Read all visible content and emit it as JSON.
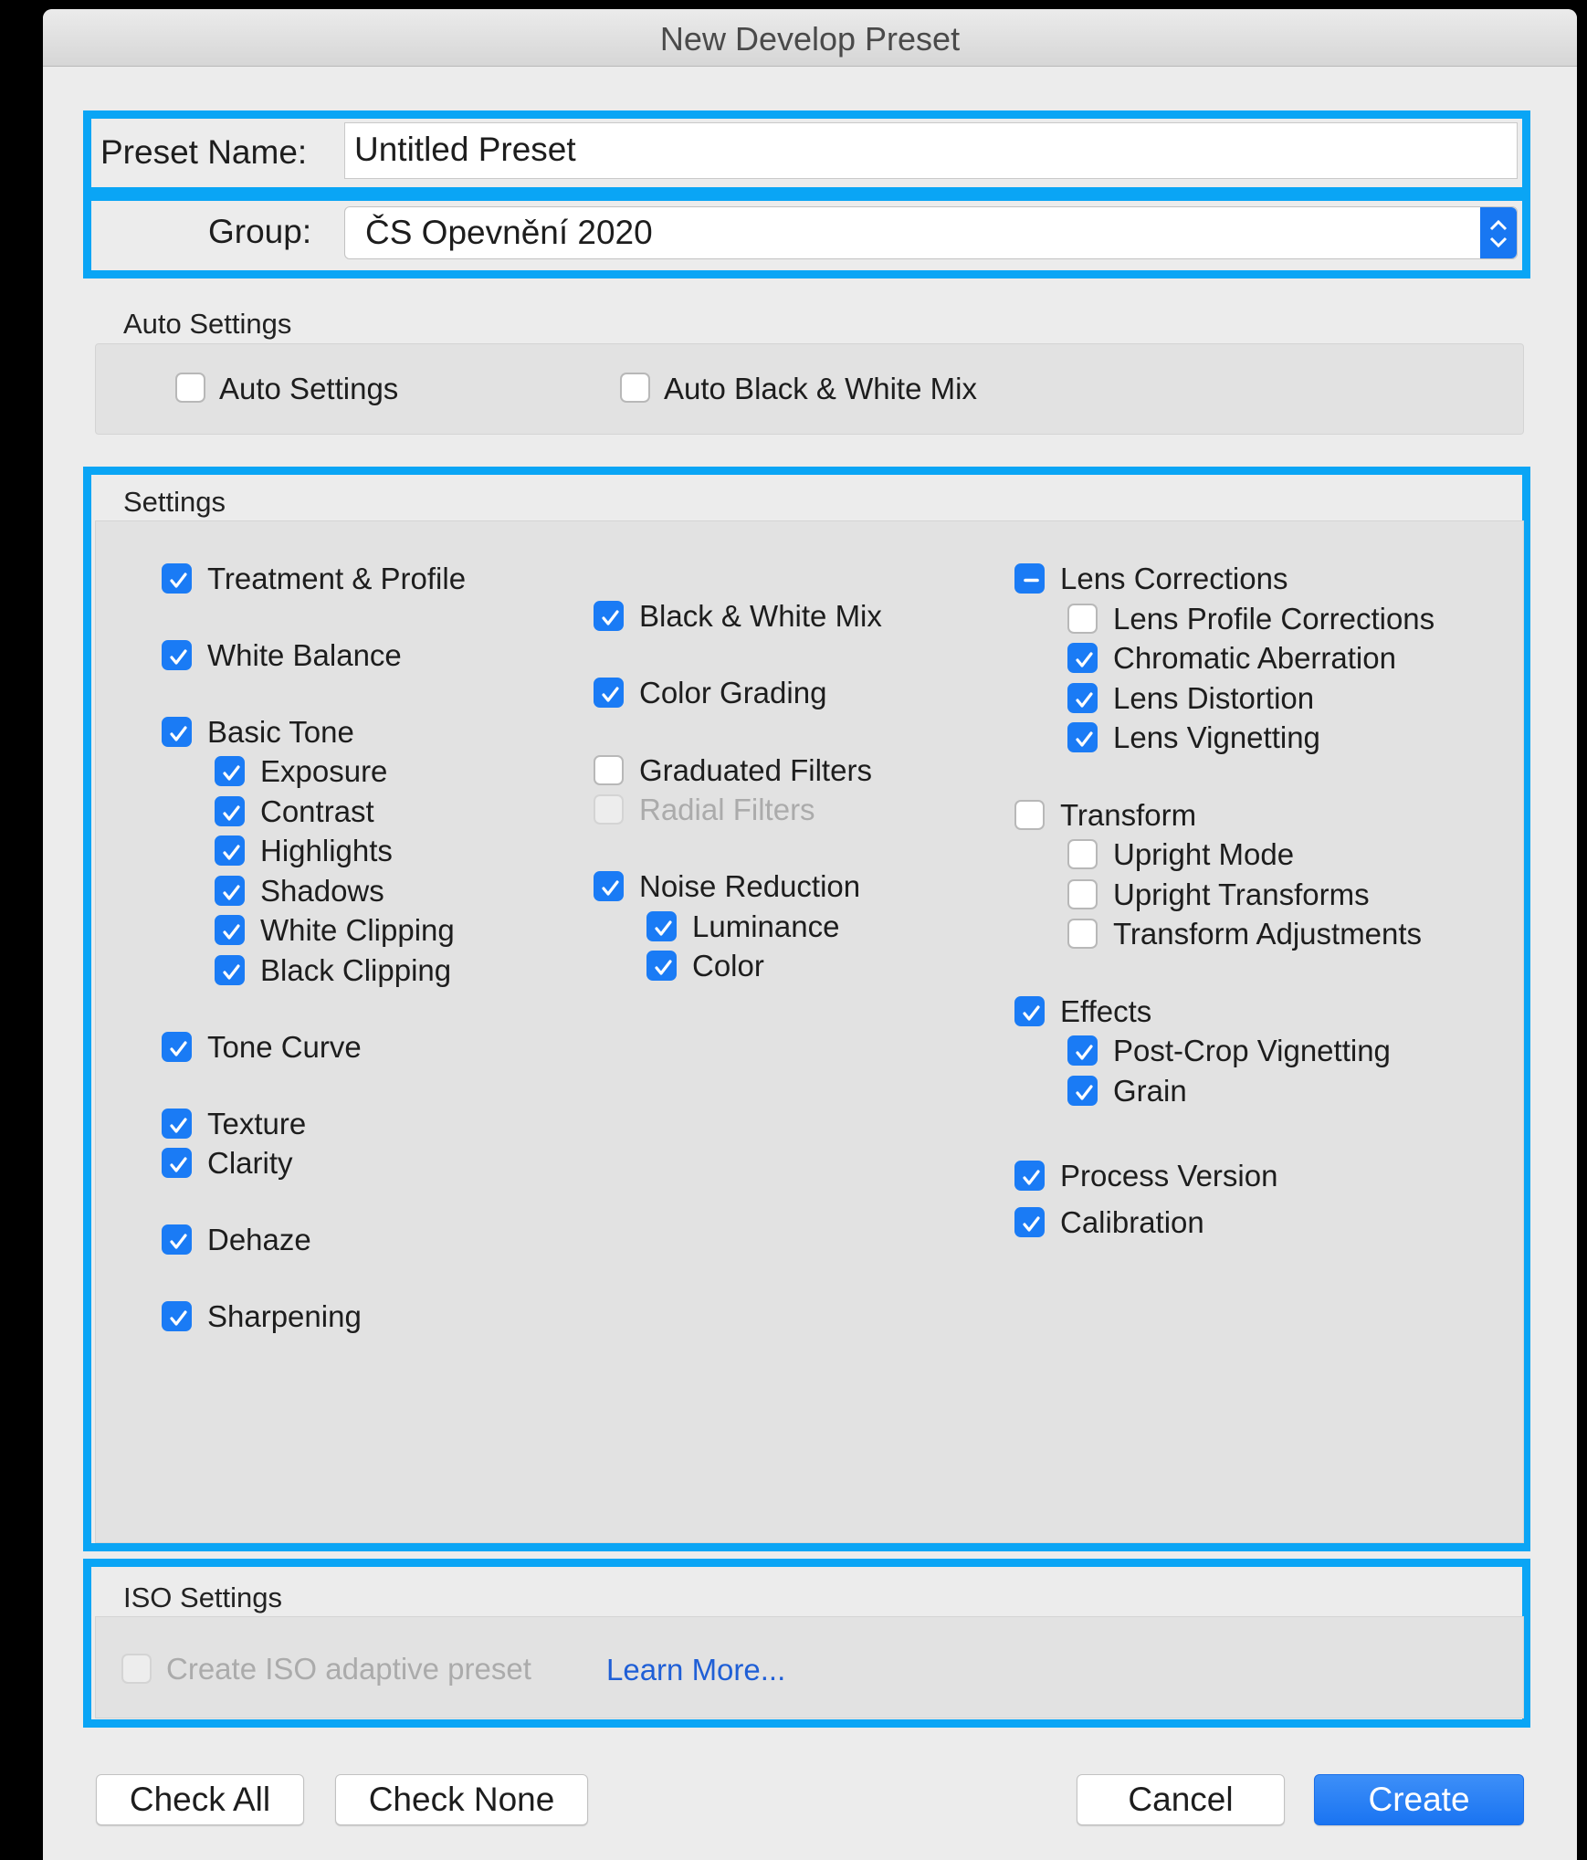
{
  "window": {
    "title": "New Develop Preset"
  },
  "preset_name": {
    "label": "Preset Name:",
    "value": "Untitled Preset"
  },
  "group": {
    "label": "Group:",
    "value": "ČS Opevnění 2020"
  },
  "auto_settings": {
    "title": "Auto Settings",
    "items": [
      {
        "label": "Auto Settings",
        "checked": false
      },
      {
        "label": "Auto Black & White Mix",
        "checked": false
      }
    ]
  },
  "settings": {
    "title": "Settings",
    "col1": [
      {
        "label": "Treatment & Profile",
        "state": "checked"
      },
      {
        "label": "White Balance",
        "state": "checked"
      },
      {
        "label": "Basic Tone",
        "state": "checked"
      },
      {
        "label": "Exposure",
        "state": "checked"
      },
      {
        "label": "Contrast",
        "state": "checked"
      },
      {
        "label": "Highlights",
        "state": "checked"
      },
      {
        "label": "Shadows",
        "state": "checked"
      },
      {
        "label": "White Clipping",
        "state": "checked"
      },
      {
        "label": "Black Clipping",
        "state": "checked"
      },
      {
        "label": "Tone Curve",
        "state": "checked"
      },
      {
        "label": "Texture",
        "state": "checked"
      },
      {
        "label": "Clarity",
        "state": "checked"
      },
      {
        "label": "Dehaze",
        "state": "checked"
      },
      {
        "label": "Sharpening",
        "state": "checked"
      }
    ],
    "col2": [
      {
        "label": "Black  &  White Mix",
        "state": "checked"
      },
      {
        "label": "Color Grading",
        "state": "checked"
      },
      {
        "label": "Graduated Filters",
        "state": "unchecked"
      },
      {
        "label": "Radial Filters",
        "state": "disabled"
      },
      {
        "label": "Noise Reduction",
        "state": "checked"
      },
      {
        "label": "Luminance",
        "state": "checked"
      },
      {
        "label": "Color",
        "state": "checked"
      }
    ],
    "col3": [
      {
        "label": "Lens Corrections",
        "state": "mixed"
      },
      {
        "label": "Lens Profile Corrections",
        "state": "unchecked"
      },
      {
        "label": "Chromatic Aberration",
        "state": "checked"
      },
      {
        "label": "Lens Distortion",
        "state": "checked"
      },
      {
        "label": "Lens Vignetting",
        "state": "checked"
      },
      {
        "label": "Transform",
        "state": "unchecked"
      },
      {
        "label": "Upright Mode",
        "state": "unchecked"
      },
      {
        "label": "Upright Transforms",
        "state": "unchecked"
      },
      {
        "label": "Transform Adjustments",
        "state": "unchecked"
      },
      {
        "label": "Effects",
        "state": "checked"
      },
      {
        "label": "Post-Crop Vignetting",
        "state": "checked"
      },
      {
        "label": "Grain",
        "state": "checked"
      },
      {
        "label": "Process Version",
        "state": "checked"
      },
      {
        "label": "Calibration",
        "state": "checked"
      }
    ]
  },
  "iso_settings": {
    "title": "ISO Settings",
    "adaptive_label": "Create ISO adaptive preset",
    "learn_more": "Learn More..."
  },
  "buttons": {
    "check_all": "Check All",
    "check_none": "Check None",
    "cancel": "Cancel",
    "create": "Create"
  },
  "colors": {
    "accent": "#1a7bf5",
    "highlight": "#0aa5f5"
  }
}
